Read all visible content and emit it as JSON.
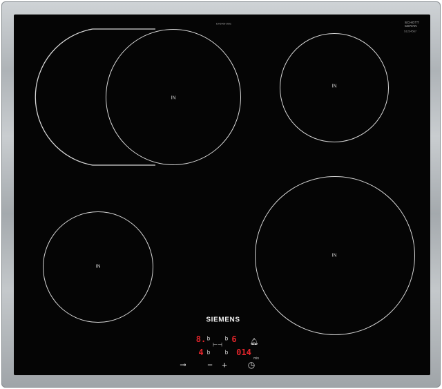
{
  "model_code": "EH645HJ6E",
  "serial_text": "S1234567",
  "glass_brand": "SCHOTT CERAN",
  "glass_brand_line1": "SCHOTT",
  "glass_brand_line2": "CERAN",
  "zones": {
    "zone_label": "IN"
  },
  "brand": {
    "name": "SIEMENS"
  },
  "display": {
    "power_left_top": "8.",
    "power_left_bottom": "4",
    "power_right_top": "6",
    "timer_value": "014",
    "booster_top_left": "b",
    "booster_top_right": "b",
    "booster_bottom_left": "b",
    "booster_bottom_right": "b",
    "min_label": "min"
  },
  "controls": {
    "lock_key": "⊸",
    "minus_key": "−",
    "plus_key": "+",
    "timer_key": "◷",
    "alarm_icon": "bell-icon",
    "flex_icon": "flex-zone-icon"
  }
}
